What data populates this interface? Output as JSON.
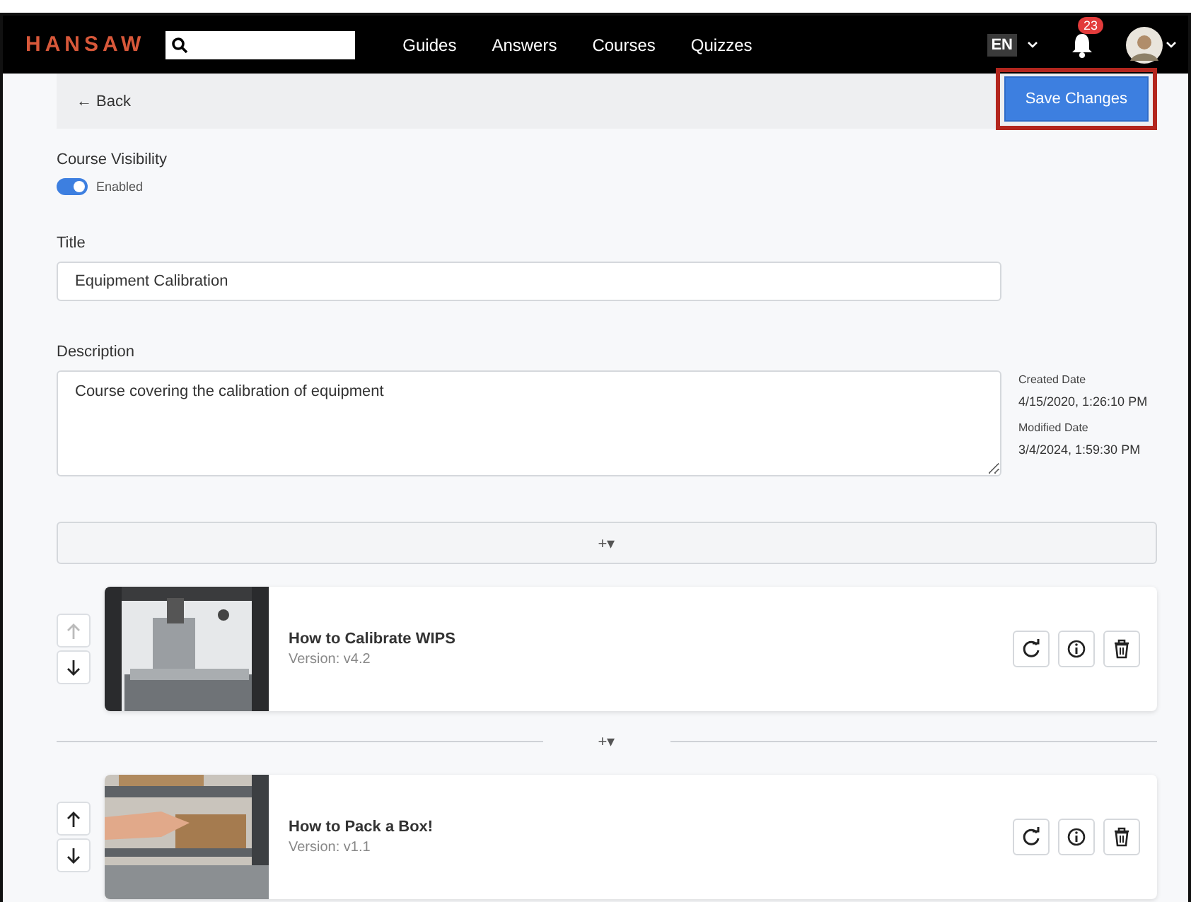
{
  "nav": {
    "logo": "HANSAW",
    "links": [
      "Guides",
      "Answers",
      "Courses",
      "Quizzes"
    ],
    "language": "EN",
    "notifications": "23"
  },
  "toolbar": {
    "back": "← Back",
    "save": {
      "label": "Save Changes",
      "highlighted": true
    }
  },
  "visibility": {
    "label": "Course Visibility",
    "on": true,
    "state_label": "Enabled"
  },
  "title_field": {
    "label": "Title",
    "value": "Equipment Calibration"
  },
  "description_field": {
    "label": "Description",
    "value": "Course covering the calibration of equipment"
  },
  "dates": [
    {
      "label": "Created Date",
      "value": "4/15/2020, 1:26:10 PM"
    },
    {
      "label": "Modified Date",
      "value": "3/4/2024, 1:59:30 PM"
    }
  ],
  "insert_label": "+▾",
  "guides": [
    {
      "title": "How to Calibrate WIPS",
      "version": "Version: v4.2",
      "up_disabled": true,
      "down_disabled": false
    },
    {
      "title": "How to Pack a Box!",
      "version": "Version: v1.1",
      "up_disabled": false,
      "down_disabled": false
    }
  ],
  "insert_between": "+▾"
}
